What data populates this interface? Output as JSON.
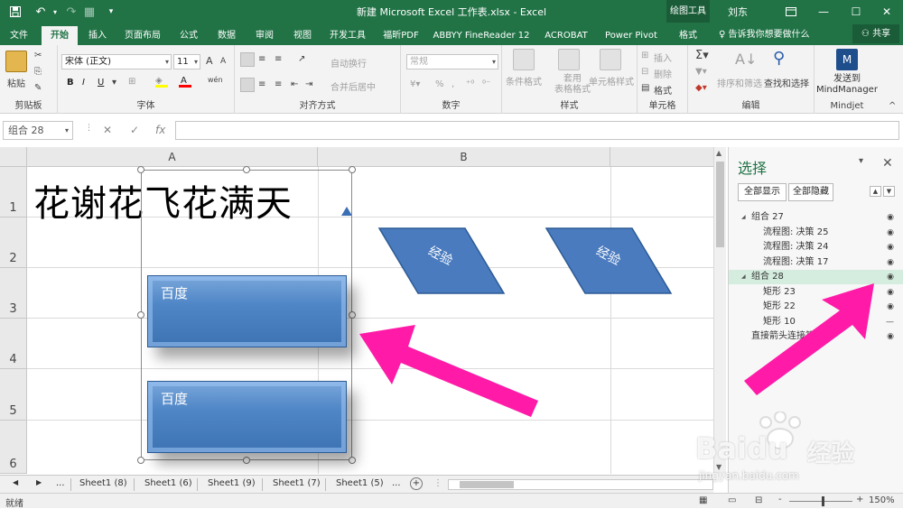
{
  "titlebar": {
    "title": "新建 Microsoft Excel 工作表.xlsx  -  Excel",
    "context_tab": "绘图工具",
    "user": "刘东"
  },
  "tabs": [
    "文件",
    "开始",
    "插入",
    "页面布局",
    "公式",
    "数据",
    "审阅",
    "视图",
    "开发工具",
    "福昕PDF",
    "ABBYY FineReader 12",
    "ACROBAT",
    "Power Pivot",
    "格式"
  ],
  "active_tab": "开始",
  "tell_me": "告诉我你想要做什么",
  "share": "共享",
  "ribbon": {
    "clipboard": {
      "paste": "粘贴",
      "label": "剪贴板"
    },
    "font": {
      "name": "宋体 (正文)",
      "size": "11",
      "label": "字体",
      "bold": "B",
      "italic": "I",
      "underline": "U",
      "grow": "A",
      "shrink": "A",
      "font_color": "A",
      "wen": "wén"
    },
    "alignment": {
      "wrap": "自动换行",
      "merge": "合并后居中",
      "label": "对齐方式"
    },
    "number": {
      "format": "常规",
      "label": "数字",
      "percent": "%",
      "comma": ","
    },
    "styles": {
      "conditional": "条件格式",
      "table": "套用\n表格格式",
      "cell": "单元格样式",
      "label": "样式"
    },
    "cells": {
      "insert": "插入",
      "delete": "删除",
      "format": "格式",
      "label": "单元格"
    },
    "editing": {
      "sort": "排序和筛选",
      "find": "查找和选择",
      "label": "编辑"
    },
    "mindjet": {
      "send": "发送到\nMindManager",
      "label": "Mindjet"
    }
  },
  "formula_bar": {
    "name_box": "组合 28",
    "fx": "fx",
    "cancel": "✕",
    "enter": "✓",
    "value": ""
  },
  "grid": {
    "columns": [
      "A",
      "B"
    ],
    "rows": [
      "1",
      "2",
      "3",
      "4",
      "5",
      "6"
    ],
    "cell_text": "花谢花飞花满天",
    "rect_label_1": "百度",
    "rect_label_2": "百度",
    "diamond_label_1": "经验",
    "diamond_label_2": "经验"
  },
  "sheets": [
    "Sheet1 (8)",
    "Sheet1 (6)",
    "Sheet1 (9)",
    "Sheet1 (7)",
    "Sheet1 (5)"
  ],
  "sheet_nav": {
    "more": "...",
    "more_right": "...",
    "add": "+"
  },
  "status": {
    "ready": "就绪",
    "zoom": "150%",
    "minus": "-",
    "plus": "+"
  },
  "selection_pane": {
    "title": "选择",
    "show_all": "全部显示",
    "hide_all": "全部隐藏",
    "items": [
      {
        "label": "组合 27",
        "level": 0,
        "expander": "◢",
        "visible": true
      },
      {
        "label": "流程图: 决策 25",
        "level": 1,
        "visible": true
      },
      {
        "label": "流程图: 决策 24",
        "level": 1,
        "visible": true
      },
      {
        "label": "流程图: 决策 17",
        "level": 1,
        "visible": true
      },
      {
        "label": "组合 28",
        "level": 0,
        "expander": "◢",
        "visible": true,
        "selected": true
      },
      {
        "label": "矩形 23",
        "level": 1,
        "visible": true
      },
      {
        "label": "矩形 22",
        "level": 1,
        "visible": true
      },
      {
        "label": "矩形 10",
        "level": 1,
        "visible": false
      },
      {
        "label": "直接箭头连接符",
        "level": 0,
        "visible": true
      }
    ]
  },
  "watermark": {
    "brand": "Baidu",
    "cn": "经验",
    "url": "jingyan.baidu.com"
  },
  "colors": {
    "excel_green": "#217346",
    "shape_blue": "#4a7bbf",
    "arrow_magenta": "#ff1aa8"
  }
}
